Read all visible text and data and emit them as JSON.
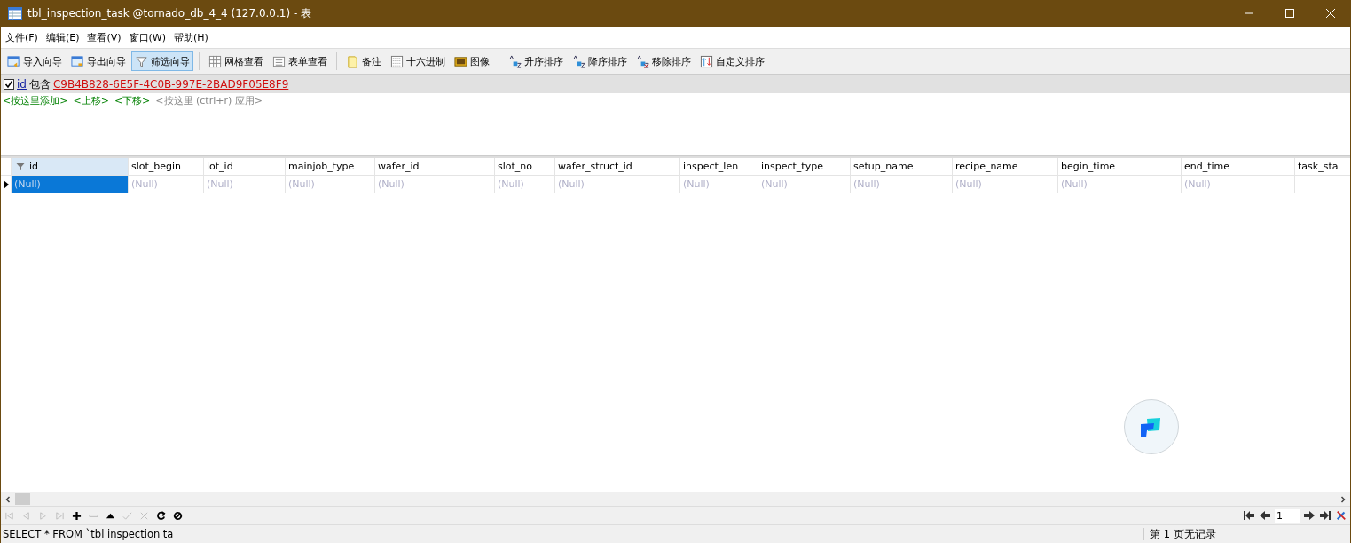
{
  "window": {
    "title": "tbl_inspection_task @tornado_db_4_4 (127.0.0.1) - 表"
  },
  "menu": [
    "文件(F)",
    "编辑(E)",
    "查看(V)",
    "窗口(W)",
    "帮助(H)"
  ],
  "toolbar": {
    "groups": [
      [
        {
          "label": "导入向导",
          "selected": false
        },
        {
          "label": "导出向导",
          "selected": false
        },
        {
          "label": "筛选向导",
          "selected": true
        }
      ],
      [
        {
          "label": "网格查看",
          "selected": false
        },
        {
          "label": "表单查看",
          "selected": false
        }
      ],
      [
        {
          "label": "备注",
          "selected": false
        },
        {
          "label": "十六进制",
          "selected": false
        },
        {
          "label": "图像",
          "selected": false
        }
      ],
      [
        {
          "label": "升序排序",
          "selected": false
        },
        {
          "label": "降序排序",
          "selected": false
        },
        {
          "label": "移除排序",
          "selected": false
        },
        {
          "label": "自定义排序",
          "selected": false
        }
      ]
    ]
  },
  "filter": {
    "checked": true,
    "field": "id",
    "operator": "包含",
    "value": "C9B4B828-6E5F-4C0B-997E-2BAD9F05E8F9",
    "actions": [
      "<按这里添加>",
      "<上移>",
      "<下移>"
    ],
    "apply": "<按这里 (ctrl+r) 应用>"
  },
  "table": {
    "columns": [
      {
        "name": "id",
        "filtered": true
      },
      {
        "name": "slot_begin",
        "filtered": false
      },
      {
        "name": "lot_id",
        "filtered": false
      },
      {
        "name": "mainjob_type",
        "filtered": false
      },
      {
        "name": "wafer_id",
        "filtered": false
      },
      {
        "name": "slot_no",
        "filtered": false
      },
      {
        "name": "wafer_struct_id",
        "filtered": false
      },
      {
        "name": "inspect_len",
        "filtered": false
      },
      {
        "name": "inspect_type",
        "filtered": false
      },
      {
        "name": "setup_name",
        "filtered": false
      },
      {
        "name": "recipe_name",
        "filtered": false
      },
      {
        "name": "begin_time",
        "filtered": false
      },
      {
        "name": "end_time",
        "filtered": false
      },
      {
        "name": "task_sta",
        "filtered": false
      }
    ],
    "rows": [
      {
        "selected": true,
        "cells": [
          "(Null)",
          "(Null)",
          "(Null)",
          "(Null)",
          "(Null)",
          "(Null)",
          "(Null)",
          "(Null)",
          "(Null)",
          "(Null)",
          "(Null)",
          "(Null)",
          "(Null)",
          ""
        ]
      }
    ]
  },
  "nav": [
    {
      "disabled": true
    },
    {
      "disabled": true
    },
    {
      "disabled": true
    },
    {
      "disabled": true
    },
    {
      "disabled": false
    },
    {
      "disabled": true
    },
    {
      "disabled": false
    },
    {
      "disabled": true
    },
    {
      "disabled": true
    },
    {
      "disabled": false
    },
    {
      "disabled": false
    }
  ],
  "page_field": {
    "value": "1"
  },
  "status_bar": {
    "sql": "SELECT * FROM `tbl inspection ta",
    "page_info": "第 1 页无记录"
  }
}
